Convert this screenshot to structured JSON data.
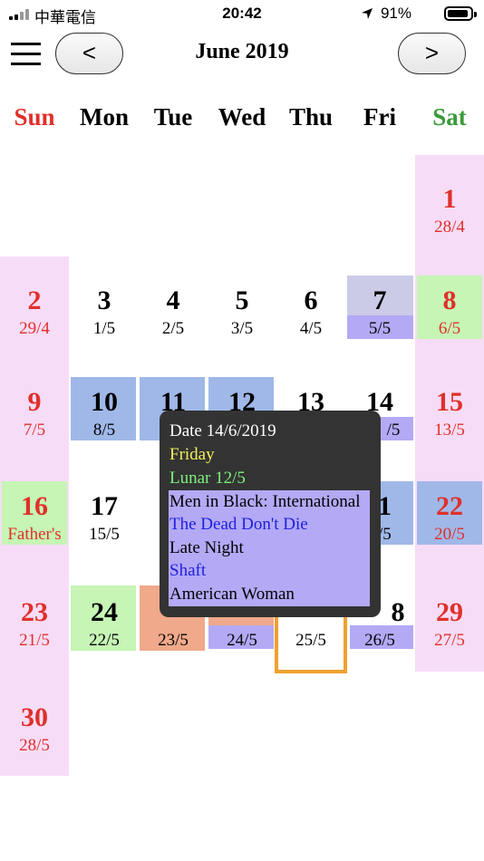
{
  "status_bar": {
    "carrier": "中華電信",
    "time": "20:42",
    "battery_percent": "91%"
  },
  "header": {
    "title": "June 2019",
    "prev_label": "<",
    "next_label": ">"
  },
  "weekdays": [
    "Sun",
    "Mon",
    "Tue",
    "Wed",
    "Thu",
    "Fri",
    "Sat"
  ],
  "colors": {
    "weekend_col": "#f7dcf7",
    "holiday": "#c6f5b5",
    "blue": "#a0b8e8",
    "purple": "#b3a9f5",
    "lavender": "#cbcbe8",
    "orange": "#f0a98a",
    "today_border": "#f0a030",
    "red_text": "#e0302a",
    "green_text": "#3a9a3a"
  },
  "days": [
    {
      "day": "1",
      "sub": "28/4"
    },
    {
      "day": "2",
      "sub": "29/4"
    },
    {
      "day": "3",
      "sub": "1/5"
    },
    {
      "day": "4",
      "sub": "2/5"
    },
    {
      "day": "5",
      "sub": "3/5"
    },
    {
      "day": "6",
      "sub": "4/5"
    },
    {
      "day": "7",
      "sub": "5/5"
    },
    {
      "day": "8",
      "sub": "6/5"
    },
    {
      "day": "9",
      "sub": "7/5"
    },
    {
      "day": "10",
      "sub": "8/5"
    },
    {
      "day": "11",
      "sub": ""
    },
    {
      "day": "12",
      "sub": ""
    },
    {
      "day": "13",
      "sub": ""
    },
    {
      "day": "14",
      "sub": "/5"
    },
    {
      "day": "15",
      "sub": "13/5"
    },
    {
      "day": "16",
      "sub": "Father's"
    },
    {
      "day": "17",
      "sub": "15/5"
    },
    {
      "day": "",
      "sub": ""
    },
    {
      "day": "",
      "sub": ""
    },
    {
      "day": "",
      "sub": ""
    },
    {
      "day": "1",
      "sub": "/5"
    },
    {
      "day": "22",
      "sub": "20/5"
    },
    {
      "day": "23",
      "sub": "21/5"
    },
    {
      "day": "24",
      "sub": "22/5"
    },
    {
      "day": "",
      "sub": "23/5"
    },
    {
      "day": "",
      "sub": "24/5"
    },
    {
      "day": "",
      "sub": "25/5"
    },
    {
      "day": "8",
      "sub": "26/5"
    },
    {
      "day": "29",
      "sub": "27/5"
    },
    {
      "day": "30",
      "sub": "28/5"
    }
  ],
  "popup": {
    "date_line": "Date 14/6/2019",
    "weekday": "Friday",
    "lunar": "Lunar 12/5",
    "movies": [
      "Men in Black: International",
      "The Dead Don't Die",
      "Late Night",
      "Shaft",
      "American Woman"
    ]
  }
}
